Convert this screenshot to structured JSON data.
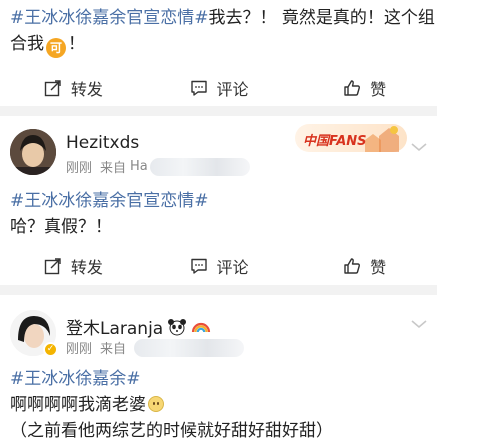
{
  "post1": {
    "hashtag": "#王冰冰徐嘉余官宣恋情#",
    "text_line1": "我去？！ 竟然是真的！这个组",
    "text_line2_start": "合我",
    "badge_char": "可",
    "text_line2_end": "！"
  },
  "actions": {
    "repost": "转发",
    "comment": "评论",
    "like": "赞"
  },
  "post2": {
    "username": "Hezitxds",
    "time": "刚刚",
    "source_prefix": "来自",
    "source_partial": "Ha",
    "badge": "中国FANS",
    "hashtag": "#王冰冰徐嘉余官宣恋情#",
    "text": "哈？真假？！"
  },
  "post3": {
    "username": "登木Laranja",
    "time": "刚刚",
    "source_prefix": "来自",
    "hashtag": "#王冰冰徐嘉余#",
    "text_line1": "啊啊啊啊我滴老婆",
    "text_line2": "（之前看他两综艺的时候就好甜好甜好甜）"
  },
  "colors": {
    "hashtag": "#4a6fa5",
    "divider": "#f2f2f2",
    "meta": "#888888"
  }
}
